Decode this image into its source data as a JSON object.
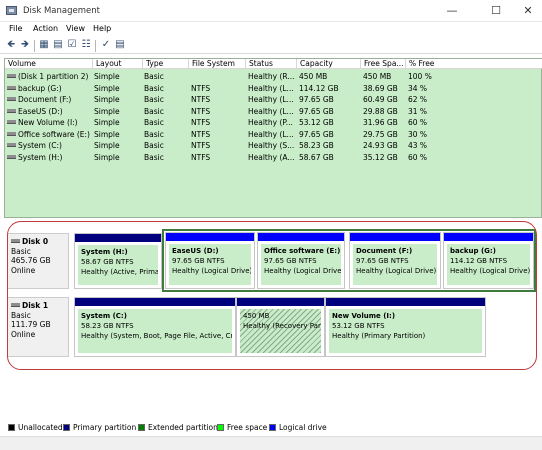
{
  "window": {
    "title": "Disk Management"
  },
  "menu": [
    "File",
    "Action",
    "View",
    "Help"
  ],
  "volume_table": {
    "headers": [
      "Volume",
      "Layout",
      "Type",
      "File System",
      "Status",
      "Capacity",
      "Free Spa...",
      "% Free"
    ],
    "rows": [
      [
        "(Disk 1 partition 2)",
        "Simple",
        "Basic",
        "",
        "Healthy (R...",
        "450 MB",
        "450 MB",
        "100 %"
      ],
      [
        "backup (G:)",
        "Simple",
        "Basic",
        "NTFS",
        "Healthy (L...",
        "114.12 GB",
        "38.69 GB",
        "34 %"
      ],
      [
        "Document (F:)",
        "Simple",
        "Basic",
        "NTFS",
        "Healthy (L...",
        "97.65 GB",
        "60.49 GB",
        "62 %"
      ],
      [
        "EaseUS (D:)",
        "Simple",
        "Basic",
        "NTFS",
        "Healthy (L...",
        "97.65 GB",
        "29.88 GB",
        "31 %"
      ],
      [
        "New Volume (I:)",
        "Simple",
        "Basic",
        "NTFS",
        "Healthy (P...",
        "53.12 GB",
        "31.96 GB",
        "60 %"
      ],
      [
        "Office software (E:)",
        "Simple",
        "Basic",
        "NTFS",
        "Healthy (L...",
        "97.65 GB",
        "29.75 GB",
        "30 %"
      ],
      [
        "System (C:)",
        "Simple",
        "Basic",
        "NTFS",
        "Healthy (S...",
        "58.23 GB",
        "24.93 GB",
        "43 %"
      ],
      [
        "System (H:)",
        "Simple",
        "Basic",
        "NTFS",
        "Healthy (A...",
        "58.67 GB",
        "35.12 GB",
        "60 %"
      ]
    ]
  },
  "disks": [
    {
      "name": "Disk 0",
      "info": [
        "Basic",
        "465.76 GB",
        "Online"
      ],
      "partitions": [
        {
          "name": "System (H:)",
          "size": "58.67 GB NTFS",
          "status": "Healthy (Active, Prima",
          "bar_color": "#00007f"
        },
        {
          "name": "EaseUS (D:)",
          "size": "97.65 GB NTFS",
          "status": "Healthy (Logical Drive)",
          "bar_color": "#0000ff"
        },
        {
          "name": "Office software (E:)",
          "size": "97.65 GB NTFS",
          "status": "Healthy (Logical Drive)",
          "bar_color": "#0000ff"
        },
        {
          "name": "Document (F:)",
          "size": "97.65 GB NTFS",
          "status": "Healthy (Logical Drive)",
          "bar_color": "#0000ff"
        },
        {
          "name": "backup (G:)",
          "size": "114.12 GB NTFS",
          "status": "Healthy (Logical Drive)",
          "bar_color": "#0000ff"
        }
      ]
    },
    {
      "name": "Disk 1",
      "info": [
        "Basic",
        "111.79 GB",
        "Online"
      ],
      "partitions": [
        {
          "name": "System (C:)",
          "size": "58.23 GB NTFS",
          "status": "Healthy (System, Boot, Page File, Active, Cr",
          "bar_color": "#00007f"
        },
        {
          "name": "",
          "size": "450 MB",
          "status": "Healthy (Recovery Part",
          "bar_color": "#00007f"
        },
        {
          "name": "New Volume (I:)",
          "size": "53.12 GB NTFS",
          "status": "Healthy (Primary Partition)",
          "bar_color": "#00007f"
        }
      ]
    }
  ],
  "legend": [
    {
      "label": "Unallocated",
      "color": "#000000"
    },
    {
      "label": "Primary partition",
      "color": "#00007f"
    },
    {
      "label": "Extended partition",
      "color": "#008000"
    },
    {
      "label": "Free space",
      "color": "#00ff00"
    },
    {
      "label": "Logical drive",
      "color": "#0000ff"
    }
  ]
}
